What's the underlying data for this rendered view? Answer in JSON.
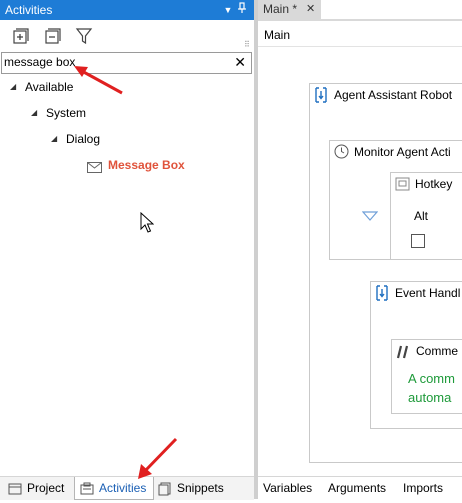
{
  "activities_panel": {
    "title": "Activities",
    "search": {
      "value": "message box"
    },
    "tree": {
      "available": "Available",
      "system": "System",
      "dialog": "Dialog",
      "message_box": "Message Box"
    },
    "bottom_tabs": {
      "project": "Project",
      "activities": "Activities",
      "snippets": "Snippets"
    }
  },
  "designer": {
    "doc_tab": "Main *",
    "breadcrumb": "Main",
    "activities": {
      "agent_assistant_robot": "Agent Assistant Robot",
      "monitor_agent": "Monitor Agent Acti",
      "hotkey": "Hotkey",
      "hotkey_modifier": "Alt",
      "event_handler": "Event Handl",
      "comment_title": "Comme",
      "comment_text_1": "A comm",
      "comment_text_2": "automa"
    },
    "bottom_tabs": {
      "variables": "Variables",
      "arguments": "Arguments",
      "imports": "Imports"
    }
  },
  "colors": {
    "title_bar": "#1e7cd6",
    "highlight_text": "#e0533b",
    "comment_text": "#1e9a3a",
    "annotation_arrow": "#e02020"
  }
}
